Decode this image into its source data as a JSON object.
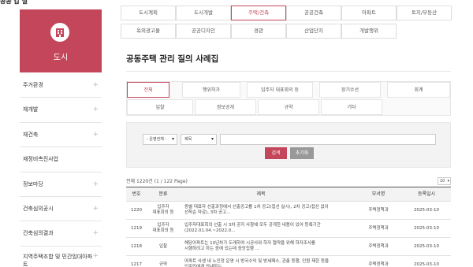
{
  "header": {
    "fragment": "공공 갑 실"
  },
  "sidebar": {
    "heading": "도시",
    "items": [
      {
        "label": "주거환경"
      },
      {
        "label": "재개발"
      },
      {
        "label": "재건축"
      },
      {
        "label": "재정비촉진사업"
      },
      {
        "label": "정보마당"
      },
      {
        "label": "건축심의공시"
      },
      {
        "label": "건축심의결과"
      },
      {
        "label": "지역주택조합 및 민간임대아파트"
      }
    ]
  },
  "categories": {
    "row1": [
      "도시계획",
      "도시개발",
      "주택/건축",
      "공공건축",
      "아파트",
      "토지/부동산"
    ],
    "row2": [
      "옥외광고물",
      "공공디자인",
      "경관",
      "산업단지",
      "개발행위"
    ],
    "active": "주택/건축"
  },
  "page_title": "공동주택 관리 질의 사례집",
  "filters": {
    "row1": [
      "전체",
      "행위허가",
      "입주자 대표회의 등",
      "장기수선",
      "회계"
    ],
    "row2": [
      "입찰",
      "정보공개",
      "규약",
      "기타"
    ],
    "active": "전체"
  },
  "search": {
    "org_select": "- 운영전체 -",
    "field_select": "제목",
    "query": "",
    "search_label": "검색",
    "reset_label": "초기화"
  },
  "list": {
    "count_text": "전체 1220건 (1 / 122 Page)",
    "page_size": "10",
    "columns": [
      "번호",
      "분류",
      "제목",
      "부서명",
      "등록일시"
    ],
    "rows": [
      {
        "no": "1220",
        "category": "입주자\n대표회의 등",
        "title": "동별 대표자 선출과정에서 선출공고를 1차 공고(접선 실시), 2차 공고(접선 없이\n선착순 마감), 3차 공고...",
        "dept": "주택정책과",
        "date": "2025-03-10"
      },
      {
        "no": "1219",
        "category": "입주자\n대표회의 등",
        "title": "입주자대표회의 선출 시 3차 공지 사항에 모두 공개한 내용이 있어 등록기간\n(2022.01.04.~2022.0...",
        "dept": "주택정책과",
        "date": "2025-03-10"
      },
      {
        "no": "1218",
        "category": "입찰",
        "title": "해당아파트는 10년차가 도래하여 시공사와 하자 협약을 위해 하자조사를\n시행하려고 하는 중에 있는데 중앙집행 ...",
        "dept": "주택정책과",
        "date": "2025-03-10"
      },
      {
        "no": "1217",
        "category": "규약",
        "title": "아파트 사생 내 노인정 운영 시 방국수익 및 방세패스, 관총 등행, 인원 제한 등을\n입주민에게 안내하는 ...",
        "dept": "주택정책과",
        "date": "2025-03-10"
      }
    ]
  },
  "colors": {
    "accent": "#c4465a",
    "button_dark": "#999999"
  }
}
